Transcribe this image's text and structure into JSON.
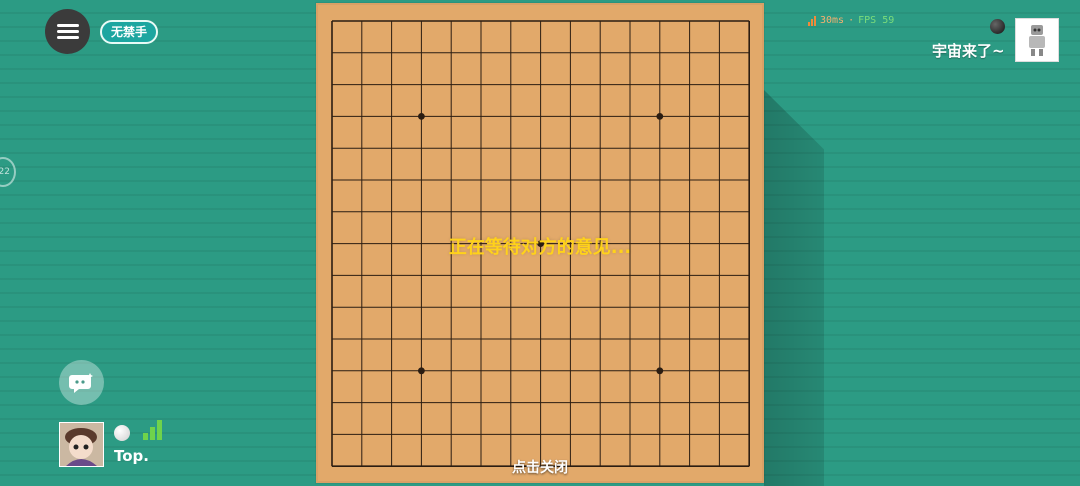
{
  "header": {
    "rule_badge": "无禁手",
    "ping_text": "30ms",
    "separator": "·",
    "fps_text": "FPS 59"
  },
  "opponent": {
    "name": "宇宙来了~",
    "stone": "black"
  },
  "timer": {
    "value": "22"
  },
  "player": {
    "name": "Top.",
    "stone": "white"
  },
  "board": {
    "size": 15,
    "star_points": [
      [
        3,
        3
      ],
      [
        11,
        3
      ],
      [
        7,
        7
      ],
      [
        3,
        11
      ],
      [
        11,
        11
      ]
    ]
  },
  "overlay": {
    "message": "正在等待对方的意见...",
    "close_hint": "点击关闭"
  },
  "icons": {
    "menu": "menu-icon",
    "chat": "chat-icon",
    "signal": "signal-icon"
  },
  "colors": {
    "message": "#ffd21a",
    "board": "#e2a96a",
    "table": "#2c9b84",
    "badge": "#1da6a0"
  }
}
